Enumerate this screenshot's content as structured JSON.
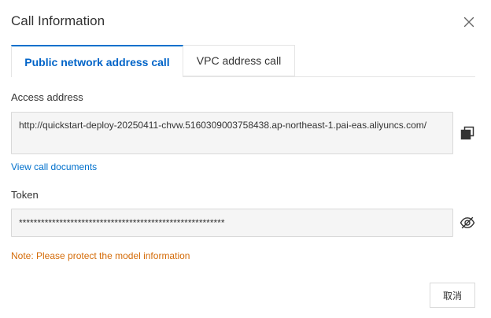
{
  "dialog": {
    "title": "Call Information"
  },
  "tabs": [
    {
      "label": "Public network address call",
      "active": true
    },
    {
      "label": "VPC address call",
      "active": false
    }
  ],
  "access_address": {
    "label": "Access address",
    "value": "http://quickstart-deploy-20250411-chvw.5160309003758438.ap-northeast-1.pai-eas.aliyuncs.com/"
  },
  "view_docs_link": "View call documents",
  "token": {
    "label": "Token",
    "value": "********************************************************"
  },
  "note": "Note: Please protect the model information",
  "footer": {
    "cancel_label": "取消"
  },
  "icons": {
    "close": "close-icon",
    "copy": "copy-icon",
    "eye": "eye-hidden-icon"
  },
  "colors": {
    "accent": "#0070cc",
    "note": "#d46b08",
    "field_bg": "#f5f5f5"
  }
}
